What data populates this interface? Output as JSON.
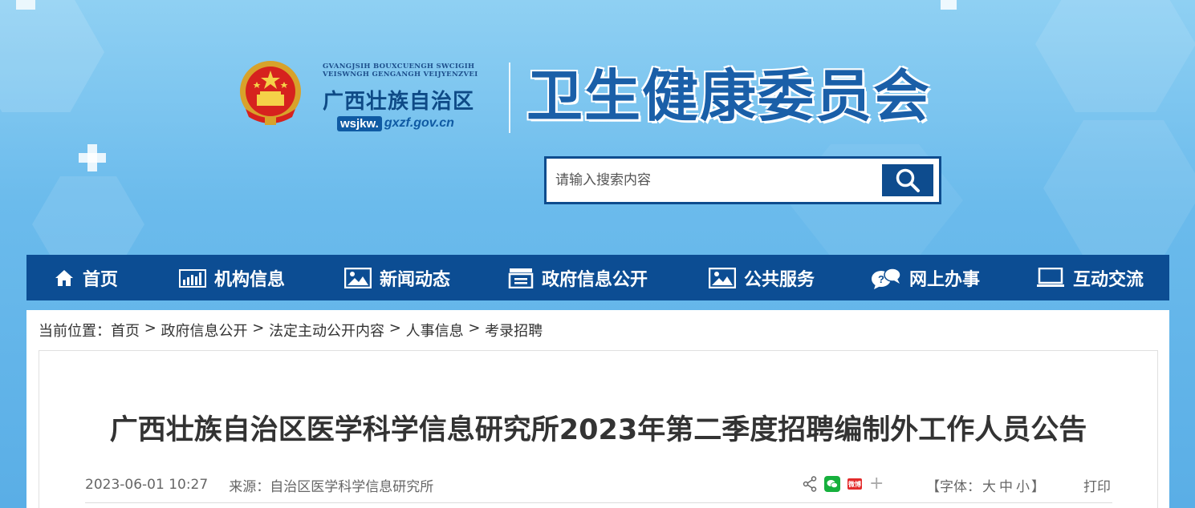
{
  "header": {
    "brand_en_line1": "GVANGJSIH BOUXCUENGH SWCIGIH",
    "brand_en_line2": "VEISWNGH GENGANGH VEIJYENZVEI",
    "brand_cn": "广西壮族自治区",
    "domain_prefix": "wsjkw.",
    "domain_suffix": "gxzf.gov.cn",
    "site_title": "卫生健康委员会"
  },
  "search": {
    "placeholder": "请输入搜索内容",
    "icon": "search-icon"
  },
  "nav": {
    "items": [
      {
        "label": "首页",
        "icon": "home-icon"
      },
      {
        "label": "机构信息",
        "icon": "bar-chart-icon"
      },
      {
        "label": "新闻动态",
        "icon": "image-icon"
      },
      {
        "label": "政府信息公开",
        "icon": "document-icon"
      },
      {
        "label": "公共服务",
        "icon": "image-icon"
      },
      {
        "label": "网上办事",
        "icon": "chat-icon"
      },
      {
        "label": "互动交流",
        "icon": "monitor-icon"
      }
    ]
  },
  "breadcrumb": {
    "prefix": "当前位置：",
    "items": [
      "首页",
      "政府信息公开",
      "法定主动公开内容",
      "人事信息",
      "考录招聘"
    ],
    "separator": " > "
  },
  "article": {
    "title": "广西壮族自治区医学科学信息研究所2023年第二季度招聘编制外工作人员公告",
    "date": "2023-06-01 10:27",
    "source_label": "来源：",
    "source": "自治区医学科学信息研究所",
    "font_label_open": "【字体：",
    "font_large": "大",
    "font_medium": "中",
    "font_small": "小",
    "font_label_close": "】",
    "print_label": "打印",
    "weibo_text": "微博"
  },
  "colors": {
    "nav_bg": "#0c4d93",
    "title_blue": "#1a5fa8",
    "wechat_green": "#16b03d",
    "weibo_red": "#e32b2b"
  }
}
